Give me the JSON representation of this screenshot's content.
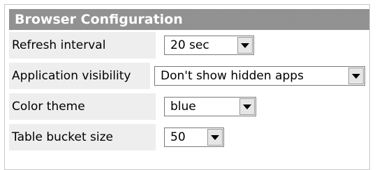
{
  "panel": {
    "title": "Browser Configuration"
  },
  "settings": [
    {
      "label": "Refresh interval",
      "value": "20 sec"
    },
    {
      "label": "Application visibility",
      "value": "Don't show hidden apps"
    },
    {
      "label": "Color theme",
      "value": "blue"
    },
    {
      "label": "Table bucket size",
      "value": "50"
    }
  ],
  "icons": {
    "dropdown": "chevron-down-icon"
  }
}
